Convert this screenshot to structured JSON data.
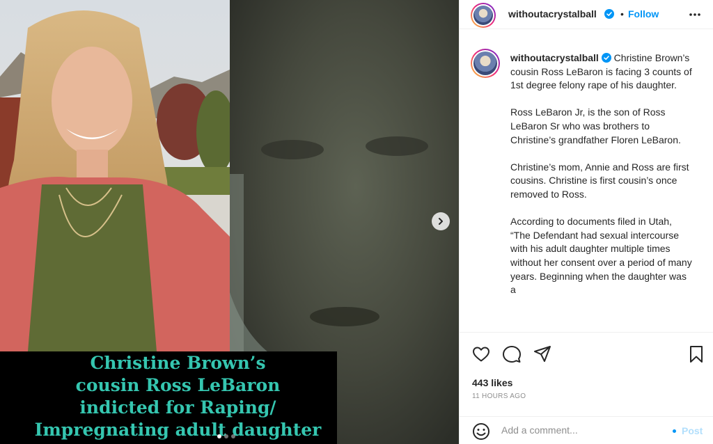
{
  "post": {
    "caption_overlay": [
      "Christine Brown’s",
      "cousin Ross LeBaron",
      "indicted for Raping/",
      "Impregnating adult daughter"
    ],
    "carousel": {
      "slides": 3,
      "active": 1
    }
  },
  "header": {
    "username": "withoutacrystalball",
    "separator": "•",
    "follow_label": "Follow"
  },
  "caption": {
    "username": "withoutacrystalball",
    "first_line": "Christine Brown’s cousin Ross LeBaron is facing 3 counts of 1st degree felony rape of his daughter.",
    "paragraphs": [
      "Ross LeBaron Jr, is the son of Ross LeBaron Sr who was brothers to Christine’s grandfather Floren LeBaron.",
      "Christine’s mom, Annie and Ross are first cousins. Christine is first cousin’s once removed to Ross.",
      "According to documents filed in Utah, “The Defendant had sexual intercourse with his adult daughter multiple times without her consent over a period of many years. Beginning when the daughter was a"
    ]
  },
  "engagement": {
    "likes": "443 likes",
    "time_ago": "11 HOURS AGO"
  },
  "comment_box": {
    "placeholder": "Add a comment...",
    "post_label": "Post"
  },
  "icons": {
    "like": "heart-icon",
    "comment": "comment-icon",
    "share": "share-icon",
    "save": "bookmark-icon",
    "more": "more-options-icon",
    "emoji": "emoji-icon",
    "next": "chevron-right-icon",
    "verified": "verified-badge-icon"
  },
  "colors": {
    "accent": "#0095f6",
    "caption_text": "#35c6b0",
    "verified": "#0095f6"
  }
}
